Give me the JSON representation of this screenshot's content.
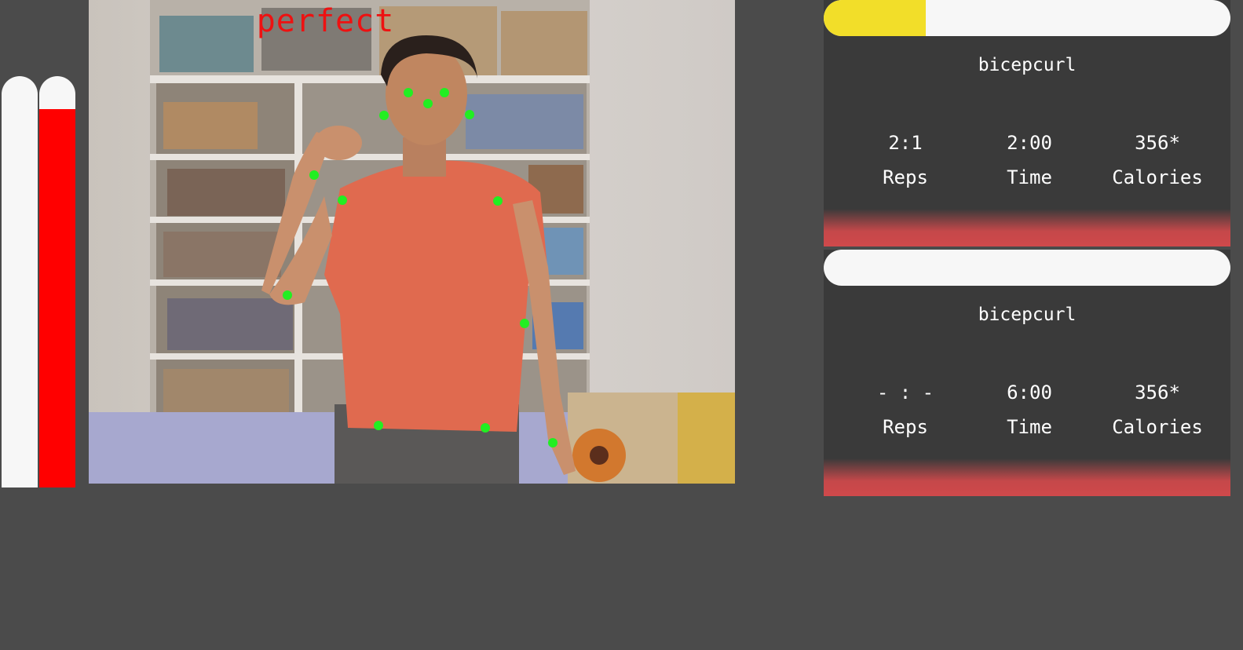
{
  "left_bars": {
    "left": {
      "fill_fraction": 0.0,
      "color": "#f7f7f7"
    },
    "right": {
      "fill_fraction": 0.92,
      "color": "#ff0000"
    }
  },
  "camera": {
    "feedback": "perfect",
    "feedback_color": "#ee1111",
    "landmark_color": "#22ee22"
  },
  "panels": [
    {
      "progress_fraction": 0.25,
      "progress_color": "#f2de29",
      "exercise": "bicepcurl",
      "reps_value": "2:1",
      "reps_label": "Reps",
      "time_value": "2:00",
      "time_label": "Time",
      "calories_value": "356*",
      "calories_label": "Calories"
    },
    {
      "progress_fraction": 0.0,
      "progress_color": "#f2de29",
      "exercise": "bicepcurl",
      "reps_value": "- : -",
      "reps_label": "Reps",
      "time_value": "6:00",
      "time_label": "Time",
      "calories_value": "356*",
      "calories_label": "Calories"
    }
  ]
}
